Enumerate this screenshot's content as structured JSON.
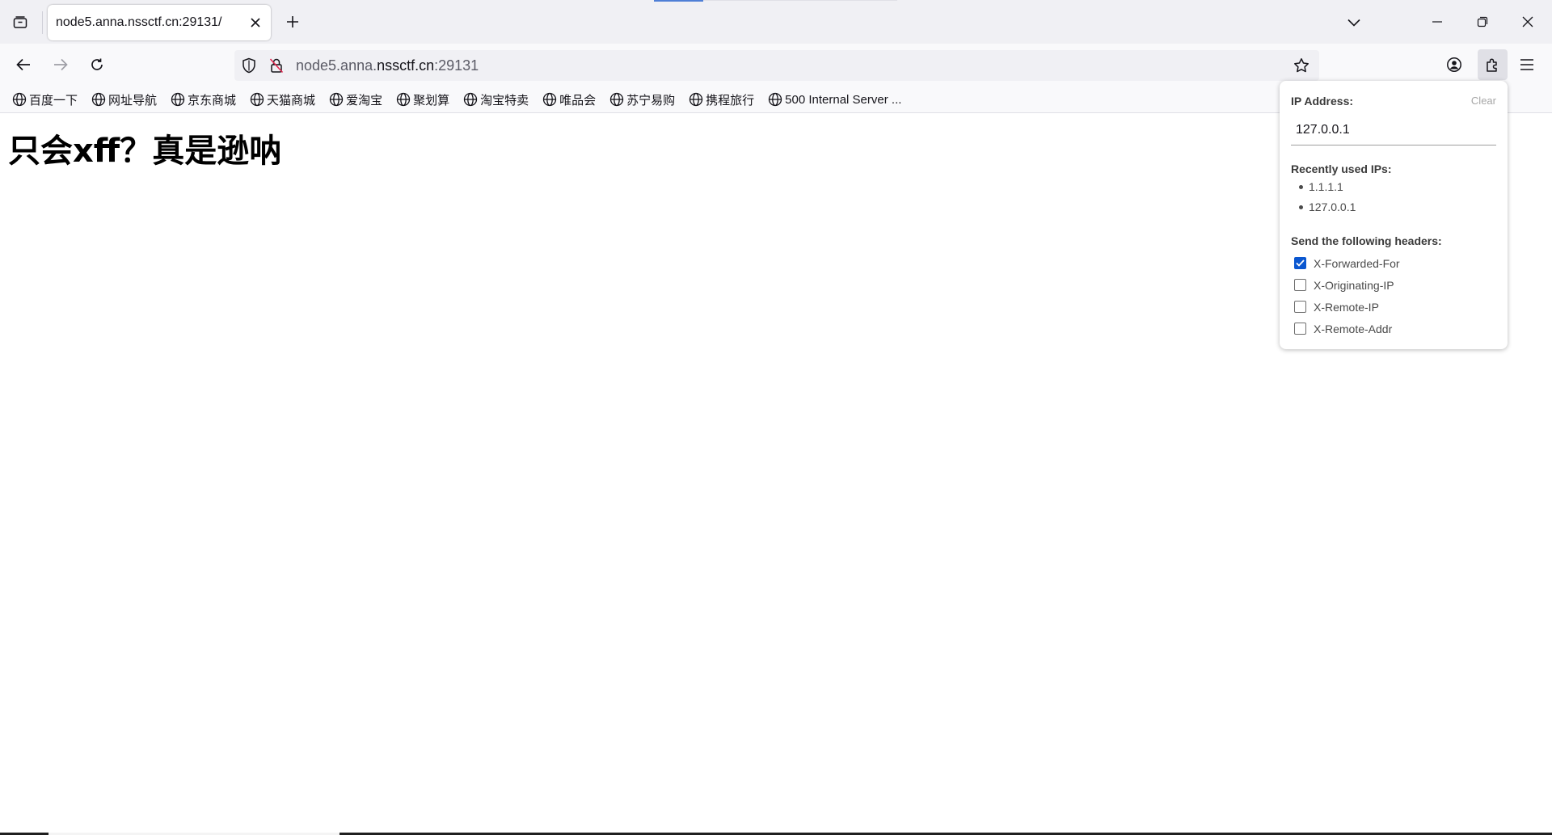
{
  "browser": {
    "tab": {
      "title": "node5.anna.nssctf.cn:29131/",
      "close_icon": "close-icon"
    },
    "url": {
      "prefix": "node5.anna.",
      "host": "nssctf.cn",
      "suffix": ":29131"
    },
    "bookmarks": [
      {
        "label": "百度一下",
        "icon": "globe-icon"
      },
      {
        "label": "网址导航",
        "icon": "globe-icon"
      },
      {
        "label": "京东商城",
        "icon": "globe-icon"
      },
      {
        "label": "天猫商城",
        "icon": "globe-icon"
      },
      {
        "label": "爱淘宝",
        "icon": "globe-icon"
      },
      {
        "label": "聚划算",
        "icon": "globe-icon"
      },
      {
        "label": "淘宝特卖",
        "icon": "globe-icon"
      },
      {
        "label": "唯品会",
        "icon": "globe-icon"
      },
      {
        "label": "苏宁易购",
        "icon": "globe-icon"
      },
      {
        "label": "携程旅行",
        "icon": "globe-icon"
      },
      {
        "label": "500 Internal Server ...",
        "icon": "globe-icon"
      }
    ]
  },
  "page": {
    "heading": "只会xff？真是逊呐"
  },
  "extension_popup": {
    "ip_label": "IP Address:",
    "clear_label": "Clear",
    "ip_value": "127.0.0.1",
    "recent_label": "Recently used IPs:",
    "recent_ips": [
      "1.1.1.1",
      "127.0.0.1"
    ],
    "headers_label": "Send the following headers:",
    "headers": [
      {
        "name": "X-Forwarded-For",
        "checked": true
      },
      {
        "name": "X-Originating-IP",
        "checked": false
      },
      {
        "name": "X-Remote-IP",
        "checked": false
      },
      {
        "name": "X-Remote-Addr",
        "checked": false
      }
    ]
  },
  "colors": {
    "accent": "#0b57d0",
    "tabstrip_bg": "#f0f0f4",
    "toolbar_bg": "#f9f9fb"
  }
}
